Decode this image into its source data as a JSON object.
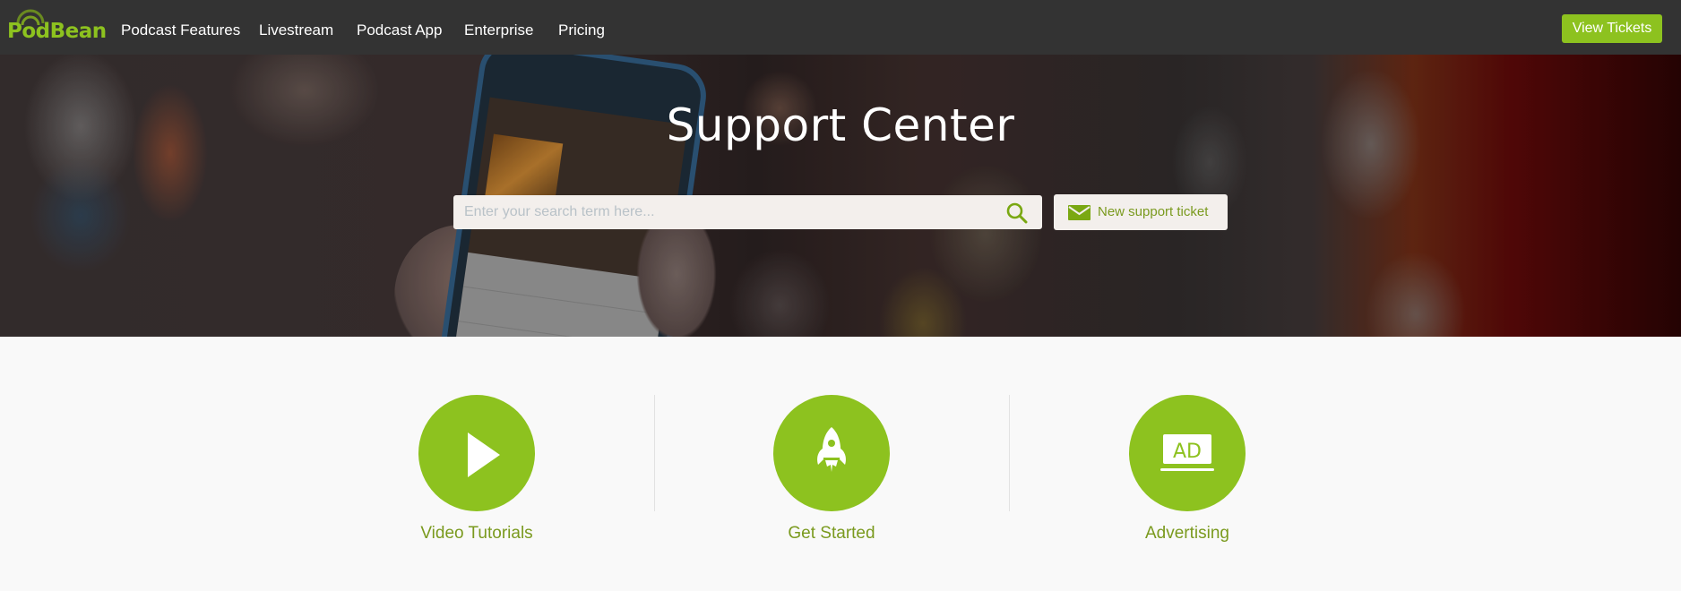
{
  "navbar": {
    "logo": "PodBean",
    "items": [
      {
        "label": "Podcast Features"
      },
      {
        "label": "Livestream"
      },
      {
        "label": "Podcast App"
      },
      {
        "label": "Enterprise"
      },
      {
        "label": "Pricing"
      }
    ],
    "cta_label": "View Tickets"
  },
  "hero": {
    "title": "Support Center",
    "search": {
      "placeholder": "Enter your search term here...",
      "value": "",
      "icon": "search-icon"
    },
    "ticket_button": {
      "label": "New support ticket",
      "icon": "envelope-icon"
    }
  },
  "features": [
    {
      "label": "Video Tutorials",
      "icon": "play-icon"
    },
    {
      "label": "Get Started",
      "icon": "rocket-icon"
    },
    {
      "label": "Advertising",
      "icon": "ad-icon",
      "icon_text": "AD"
    }
  ],
  "colors": {
    "brand_green": "#8dc21f",
    "label_green": "#7a9a1e",
    "navbar_bg": "#333333",
    "page_bg": "#f9f9f9",
    "input_bg": "#f3efec"
  }
}
